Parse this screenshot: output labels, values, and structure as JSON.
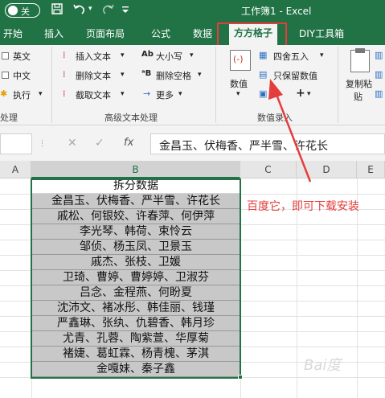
{
  "titlebar": {
    "autosave_label": "关",
    "title": "工作簿1 - Excel",
    "save_icon": "save-icon",
    "undo_icon": "undo-icon",
    "redo_icon": "redo-icon"
  },
  "tabs": [
    "开始",
    "插入",
    "页面布局",
    "公式",
    "数据",
    "方方格子",
    "DIY工具箱"
  ],
  "ribbon": {
    "left": [
      "英文",
      "中文",
      "执行"
    ],
    "left_group": "处理",
    "text_tools": [
      "插入文本",
      "删除文本",
      "截取文本"
    ],
    "case_tools": [
      "大小写",
      "删除空格",
      "更多"
    ],
    "text_group": "高级文本处理",
    "numeric_label": "数值",
    "round_label": "四舍五入",
    "keep_value_label": "只保留数值",
    "plus": "+",
    "numeric_group": "数值录入",
    "paste_label_1": "复制粘",
    "paste_label_2": "贴"
  },
  "formula": {
    "cancel": "✕",
    "confirm": "✓",
    "fx": "fx",
    "content": "金昌玉、伏梅香、严半雪、许花长"
  },
  "grid": {
    "columns": [
      "A",
      "B",
      "C",
      "D",
      "E"
    ],
    "header": "拆分数据",
    "rows": [
      "金昌玉、伏梅香、严半雪、许花长",
      "戚松、何银姣、许春萍、何伊萍",
      "李光琴、韩荷、束怜云",
      "邹侦、杨玉凤、卫景玉",
      "戚杰、张枝、卫媛",
      "卫琦、曹婷、曹婷婷、卫淑芬",
      "吕念、金程燕、何盼夏",
      "沈沛文、褚冰彤、韩佳丽、钱瑾",
      "严鑫琳、张纨、仇碧香、韩月珍",
      "尤青、孔蓉、陶紫萱、华厚菊",
      "褚婕、葛虹霖、杨青槐、茅淇",
      "金嘎妹、秦子鑫"
    ]
  },
  "annotation": "百度它，即可下载安装",
  "colors": {
    "excel_green": "#217346",
    "highlight_red": "#e53c3c",
    "data_fill": "#c8c8c8"
  }
}
